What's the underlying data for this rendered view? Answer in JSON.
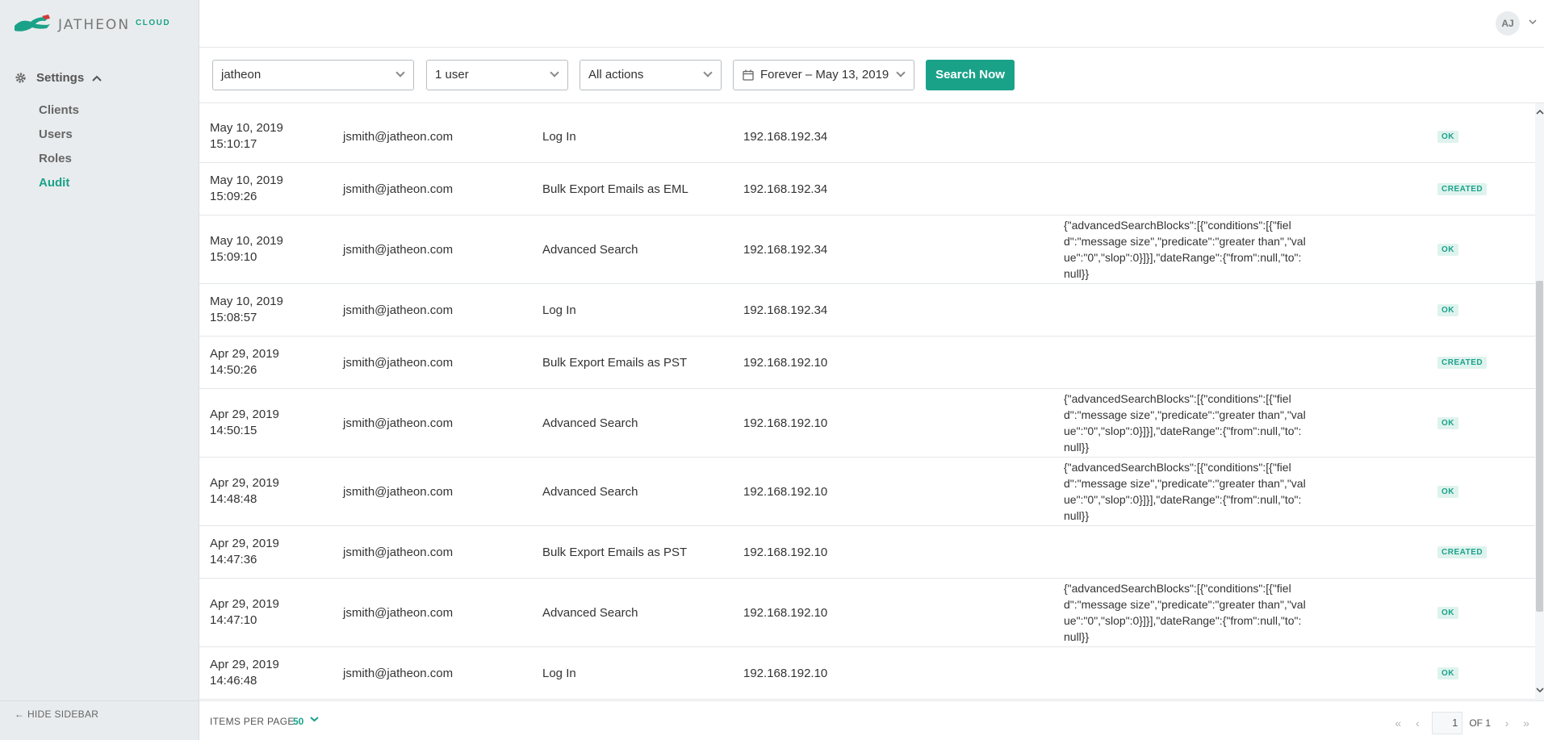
{
  "brand": {
    "name": "JATHEON",
    "suffix": "CLOUD",
    "accent": "#1aa289"
  },
  "sidebar": {
    "group_label": "Settings",
    "items": [
      {
        "label": "Clients"
      },
      {
        "label": "Users"
      },
      {
        "label": "Roles"
      },
      {
        "label": "Audit"
      }
    ],
    "active": "Audit",
    "hide_label": "HIDE SIDEBAR"
  },
  "header": {
    "avatar_initials": "AJ"
  },
  "filters": {
    "client": "jatheon",
    "users": "1 user",
    "actions": "All actions",
    "date_range": "Forever – May 13, 2019",
    "search_label": "Search Now"
  },
  "rows": [
    {
      "date": "May 10, 2019",
      "time": "15:10:17",
      "user": "jsmith@jatheon.com",
      "action": "Log In",
      "ip": "192.168.192.34",
      "details": "",
      "status": "OK"
    },
    {
      "date": "May 10, 2019",
      "time": "15:09:26",
      "user": "jsmith@jatheon.com",
      "action": "Bulk Export Emails as EML",
      "ip": "192.168.192.34",
      "details": "",
      "status": "CREATED"
    },
    {
      "date": "May 10, 2019",
      "time": "15:09:10",
      "user": "jsmith@jatheon.com",
      "action": "Advanced Search",
      "ip": "192.168.192.34",
      "details": "{\"advancedSearchBlocks\":[{\"conditions\":[{\"field\":\"message size\",\"predicate\":\"greater than\",\"value\":\"0\",\"slop\":0}]}],\"dateRange\":{\"from\":null,\"to\":null}}",
      "status": "OK"
    },
    {
      "date": "May 10, 2019",
      "time": "15:08:57",
      "user": "jsmith@jatheon.com",
      "action": "Log In",
      "ip": "192.168.192.34",
      "details": "",
      "status": "OK"
    },
    {
      "date": "Apr 29, 2019",
      "time": "14:50:26",
      "user": "jsmith@jatheon.com",
      "action": "Bulk Export Emails as PST",
      "ip": "192.168.192.10",
      "details": "",
      "status": "CREATED"
    },
    {
      "date": "Apr 29, 2019",
      "time": "14:50:15",
      "user": "jsmith@jatheon.com",
      "action": "Advanced Search",
      "ip": "192.168.192.10",
      "details": "{\"advancedSearchBlocks\":[{\"conditions\":[{\"field\":\"message size\",\"predicate\":\"greater than\",\"value\":\"0\",\"slop\":0}]}],\"dateRange\":{\"from\":null,\"to\":null}}",
      "status": "OK"
    },
    {
      "date": "Apr 29, 2019",
      "time": "14:48:48",
      "user": "jsmith@jatheon.com",
      "action": "Advanced Search",
      "ip": "192.168.192.10",
      "details": "{\"advancedSearchBlocks\":[{\"conditions\":[{\"field\":\"message size\",\"predicate\":\"greater than\",\"value\":\"0\",\"slop\":0}]}],\"dateRange\":{\"from\":null,\"to\":null}}",
      "status": "OK"
    },
    {
      "date": "Apr 29, 2019",
      "time": "14:47:36",
      "user": "jsmith@jatheon.com",
      "action": "Bulk Export Emails as PST",
      "ip": "192.168.192.10",
      "details": "",
      "status": "CREATED"
    },
    {
      "date": "Apr 29, 2019",
      "time": "14:47:10",
      "user": "jsmith@jatheon.com",
      "action": "Advanced Search",
      "ip": "192.168.192.10",
      "details": "{\"advancedSearchBlocks\":[{\"conditions\":[{\"field\":\"message size\",\"predicate\":\"greater than\",\"value\":\"0\",\"slop\":0}]}],\"dateRange\":{\"from\":null,\"to\":null}}",
      "status": "OK"
    },
    {
      "date": "Apr 29, 2019",
      "time": "14:46:48",
      "user": "jsmith@jatheon.com",
      "action": "Log In",
      "ip": "192.168.192.10",
      "details": "",
      "status": "OK"
    }
  ],
  "footer": {
    "items_per_page_label": "ITEMS PER PAGE",
    "items_per_page": "50",
    "page": "1",
    "of_label": "OF 1"
  }
}
